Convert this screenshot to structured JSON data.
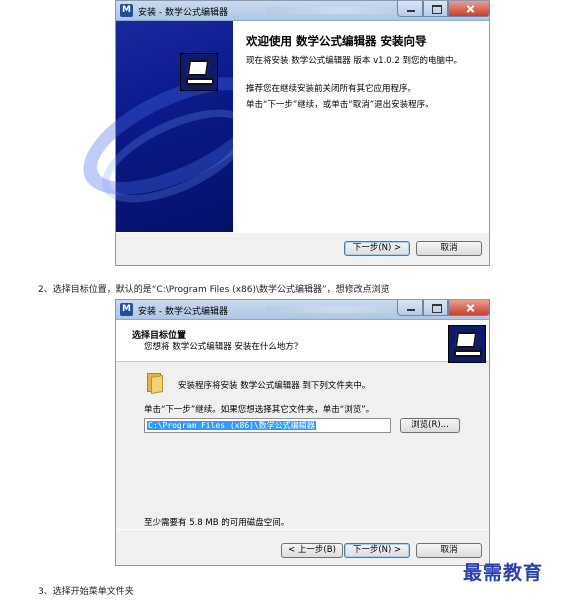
{
  "window1": {
    "app_icon": "setup-app-icon",
    "title": "安装 - 数学公式编辑器",
    "welcome_title": "欢迎使用 数学公式编辑器 安装向导",
    "line1": "现在将安装 数学公式编辑器 版本 v1.0.2 到您的电脑中。",
    "line2": "推荐您在继续安装前关闭所有其它应用程序。",
    "line3": "单击“下一步”继续，或单击“取消”退出安装程序。",
    "next_label": "下一步(N) >",
    "cancel_label": "取消"
  },
  "caption2": "2、选择目标位置，默认的是“C:\\Program Files (x86)\\数学公式编辑器”，想修改点浏览",
  "window2": {
    "title": "安装 - 数学公式编辑器",
    "header_title": "选择目标位置",
    "header_sub": "您想将 数学公式编辑器 安装在什么地方？",
    "folder_text": "安装程序将安装 数学公式编辑器 到下列文件夹中。",
    "instruction": "单击“下一步”继续。如果您想选择其它文件夹，单击“浏览”。",
    "path_value": "C:\\Program Files (x86)\\数学公式编辑器",
    "browse_label": "浏览(R)...",
    "disk_space": "至少需要有 5.8 MB 的可用磁盘空间。",
    "back_label": "< 上一步(B)",
    "next_label": "下一步(N) >",
    "cancel_label": "取消"
  },
  "caption3": "3、选择开始菜单文件夹",
  "watermark": "最需教育"
}
